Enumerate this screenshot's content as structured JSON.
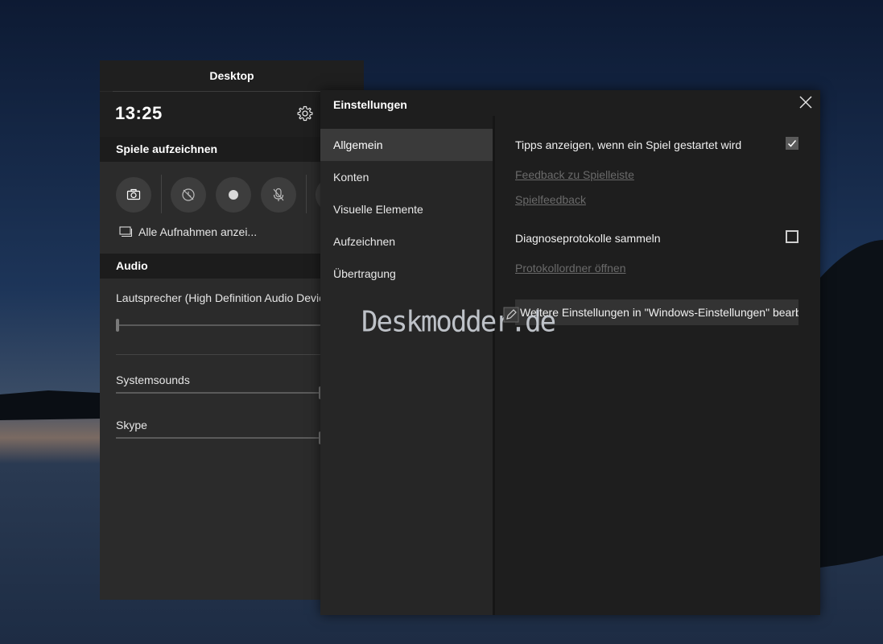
{
  "gamebar": {
    "title": "Desktop",
    "time": "13:25",
    "capture_section": "Spiele aufzeichnen",
    "show_all_captures": "Alle Aufnahmen anzei...",
    "audio_section": "Audio",
    "audio_items": [
      {
        "label": "Lautsprecher (High Definition Audio Device)",
        "level": 0.0
      },
      {
        "label": "Systemsounds",
        "level": 1.0
      },
      {
        "label": "Skype",
        "level": 1.0
      }
    ]
  },
  "settings": {
    "title": "Einstellungen",
    "nav": [
      "Allgemein",
      "Konten",
      "Visuelle Elemente",
      "Aufzeichnen",
      "Übertragung"
    ],
    "active_nav": "Allgemein",
    "options": {
      "tips_label": "Tipps anzeigen, wenn ein Spiel gestartet wird",
      "tips_checked": true,
      "feedback_link": "Feedback zu Spielleiste",
      "game_feedback_link": "Spielfeedback",
      "diag_label": "Diagnoseprotokolle sammeln",
      "diag_checked": false,
      "log_folder_link": "Protokollordner öffnen",
      "more_settings_button": "Weitere Einstellungen in \"Windows-Einstellungen\" bearbeiten"
    }
  },
  "watermark": "Deskmodder.de",
  "colors": {
    "accent_active": "#3a3a3a",
    "panel": "#2b2b2b",
    "window": "#1e1e1e"
  }
}
